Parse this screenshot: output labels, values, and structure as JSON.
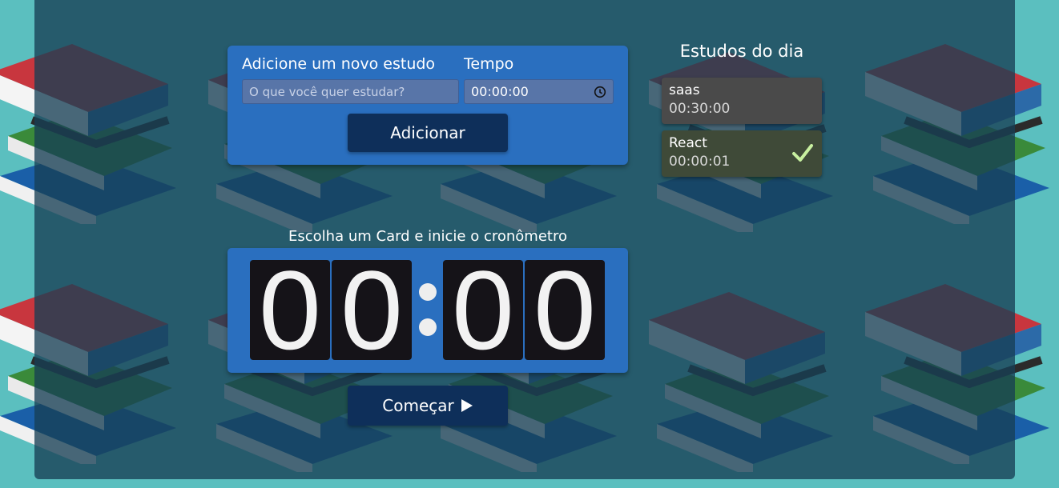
{
  "form": {
    "study_label": "Adicione um novo estudo",
    "time_label": "Tempo",
    "study_placeholder": "O que você quer estudar?",
    "time_value": "00:00:00",
    "add_button": "Adicionar"
  },
  "list": {
    "title": "Estudos do dia",
    "items": [
      {
        "name": "saas",
        "time": "00:30:00",
        "completed": false
      },
      {
        "name": "React",
        "time": "00:00:01",
        "completed": true
      }
    ]
  },
  "timer": {
    "title": "Escolha um Card e inicie o cronômetro",
    "digits": [
      "0",
      "0",
      "0",
      "0"
    ],
    "start_button": "Começar"
  },
  "colors": {
    "background": "#5bbfbf",
    "panel": "#173f54",
    "card_blue": "#2a6fbf",
    "button_navy": "#0e2f5a",
    "check_green": "#c8f0a0"
  }
}
